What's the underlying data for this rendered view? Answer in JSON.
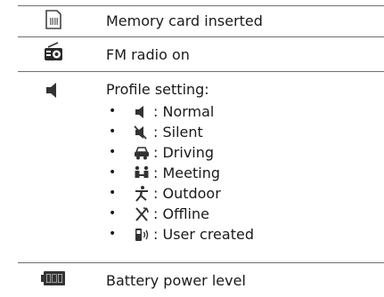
{
  "rows": [
    {
      "icon": "memory-card-icon",
      "text": "Memory card inserted"
    },
    {
      "icon": "fm-radio-icon",
      "text": "FM radio on"
    },
    {
      "icon": "speaker-icon",
      "text": "Profile setting:"
    },
    {
      "icon": "battery-icon",
      "text": "Battery power level"
    }
  ],
  "profiles": [
    {
      "icon": "normal-speaker-icon",
      "label": ": Normal"
    },
    {
      "icon": "silent-speaker-icon",
      "label": ": Silent"
    },
    {
      "icon": "car-icon",
      "label": ": Driving"
    },
    {
      "icon": "meeting-icon",
      "label": ": Meeting"
    },
    {
      "icon": "running-person-icon",
      "label": ": Outdoor"
    },
    {
      "icon": "offline-icon",
      "label": ": Offline"
    },
    {
      "icon": "user-phone-icon",
      "label": ": User created"
    }
  ],
  "bullet_char": "•"
}
